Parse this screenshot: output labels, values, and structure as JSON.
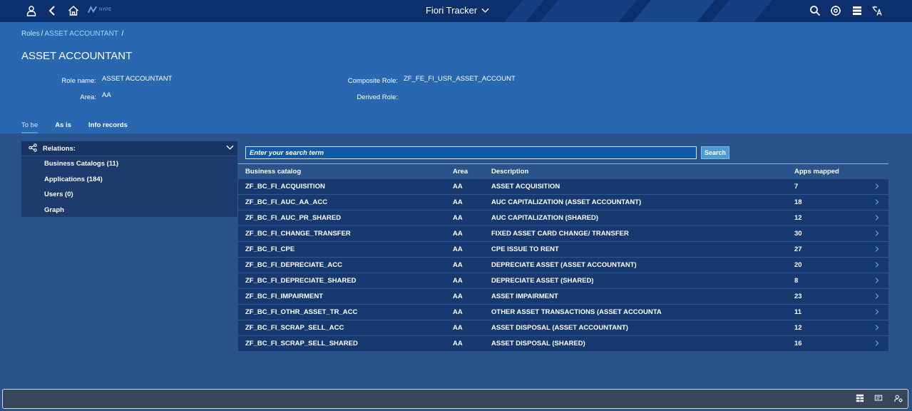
{
  "shell": {
    "title": "Fiori Tracker",
    "logo_text": "NYPE",
    "icons": [
      "user-icon",
      "back-icon",
      "home-icon",
      "search-icon",
      "settings-icon",
      "table-icon",
      "language-icon"
    ]
  },
  "breadcrumb": {
    "root": "Roles",
    "separator": "/",
    "current": "ASSET ACCOUNTANT",
    "trailing": "/"
  },
  "page": {
    "title": "ASSET ACCOUNTANT",
    "role_name_label": "Role name:",
    "role_name_value": "ASSET ACCOUNTANT",
    "area_label": "Area:",
    "area_value": "AA",
    "composite_label": "Composite Role:",
    "composite_value": "ZF_FE_FI_USR_ASSET_ACCOUNT",
    "derived_label": "Derived Role:",
    "derived_value": ""
  },
  "tabs": [
    {
      "label": "To be",
      "active": true
    },
    {
      "label": "As is",
      "active": false
    },
    {
      "label": "Info records",
      "active": false
    }
  ],
  "relations": {
    "header": "Relations:",
    "items": [
      {
        "label": "Business Catalogs (11)"
      },
      {
        "label": "Applications (184)"
      },
      {
        "label": "Users (0)"
      },
      {
        "label": "Graph"
      }
    ]
  },
  "search": {
    "placeholder": "Enter your search term",
    "button_label": "Search"
  },
  "table": {
    "headers": [
      "Business catalog",
      "Area",
      "Description",
      "Apps mapped"
    ],
    "rows": [
      {
        "catalog": "ZF_BC_FI_ACQUISITION",
        "area": "AA",
        "description": "ASSET ACQUISITION",
        "apps": "7"
      },
      {
        "catalog": "ZF_BC_FI_AUC_AA_ACC",
        "area": "AA",
        "description": "AUC CAPITALIZATION (ASSET ACCOUNTANT)",
        "apps": "18"
      },
      {
        "catalog": "ZF_BC_FI_AUC_PR_SHARED",
        "area": "AA",
        "description": "AUC CAPITALIZATION (SHARED)",
        "apps": "12"
      },
      {
        "catalog": "ZF_BC_FI_CHANGE_TRANSFER",
        "area": "AA",
        "description": "FIXED ASSET CARD CHANGE/ TRANSFER",
        "apps": "30"
      },
      {
        "catalog": "ZF_BC_FI_CPE",
        "area": "AA",
        "description": "CPE ISSUE TO RENT",
        "apps": "27"
      },
      {
        "catalog": "ZF_BC_FI_DEPRECIATE_ACC",
        "area": "AA",
        "description": "DEPRECIATE ASSET (ASSET ACCOUNTANT)",
        "apps": "20"
      },
      {
        "catalog": "ZF_BC_FI_DEPRECIATE_SHARED",
        "area": "AA",
        "description": "DEPRECIATE ASSET (SHARED)",
        "apps": "8"
      },
      {
        "catalog": "ZF_BC_FI_IMPAIRMENT",
        "area": "AA",
        "description": "ASSET IMPAIRMENT",
        "apps": "23"
      },
      {
        "catalog": "ZF_BC_FI_OTHR_ASSET_TR_ACC",
        "area": "AA",
        "description": "OTHER ASSET TRANSACTIONS (ASSET ACCOUNTA",
        "apps": "11"
      },
      {
        "catalog": "ZF_BC_FI_SCRAP_SELL_ACC",
        "area": "AA",
        "description": "ASSET DISPOSAL (ASSET ACCOUNTANT)",
        "apps": "12"
      },
      {
        "catalog": "ZF_BC_FI_SCRAP_SELL_SHARED",
        "area": "AA",
        "description": "ASSET DISPOSAL (SHARED)",
        "apps": "16"
      }
    ]
  },
  "footer": {
    "icons": [
      "table-icon",
      "message-icon",
      "user-settings-icon"
    ]
  },
  "colors": {
    "shell": "#0c2f6d",
    "header": "#2a67b1",
    "body": "#29538a",
    "row": "#17396f",
    "link": "#9fd8ff"
  }
}
